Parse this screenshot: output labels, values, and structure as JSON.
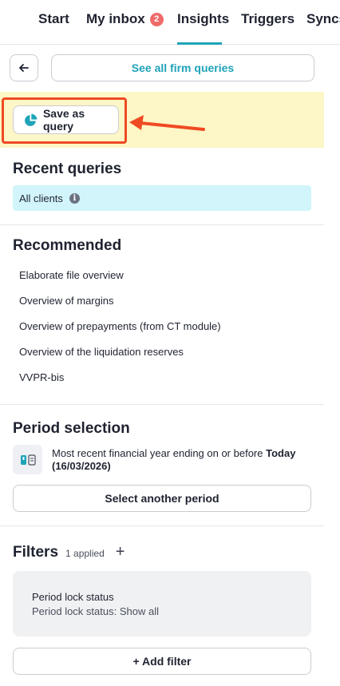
{
  "nav": {
    "tabs": [
      {
        "label": "Start"
      },
      {
        "label": "My inbox",
        "badge": "2"
      },
      {
        "label": "Insights",
        "active": true
      },
      {
        "label": "Triggers"
      },
      {
        "label": "Syncs"
      }
    ],
    "accent_color": "#1fa3b8"
  },
  "toolbar": {
    "back_icon": "arrow-left-icon",
    "see_all_label": "See all firm queries"
  },
  "save_query": {
    "label": "Save as query",
    "icon": "pie-chart-icon",
    "highlight_color": "#fdf6c6",
    "annotation_color": "#ef4a23"
  },
  "recent": {
    "heading": "Recent queries",
    "items": [
      {
        "label": "All clients",
        "icon": "info-icon"
      }
    ]
  },
  "recommended": {
    "heading": "Recommended",
    "items": [
      "Elaborate file overview",
      "Overview of margins",
      "Overview of prepayments (from CT module)",
      "Overview of the liquidation reserves",
      "VVPR-bis"
    ]
  },
  "period": {
    "heading": "Period selection",
    "icon": "calendar-columns-icon",
    "description_prefix": "Most recent financial year ending on or before ",
    "description_bold": "Today (16/03/2026)",
    "button_label": "Select another period"
  },
  "filters": {
    "heading": "Filters",
    "applied_count": "1 applied",
    "add_icon": "plus-icon",
    "card_title": "Period lock status",
    "card_subtitle": "Period lock status: Show all",
    "add_button_label": "+ Add filter"
  }
}
